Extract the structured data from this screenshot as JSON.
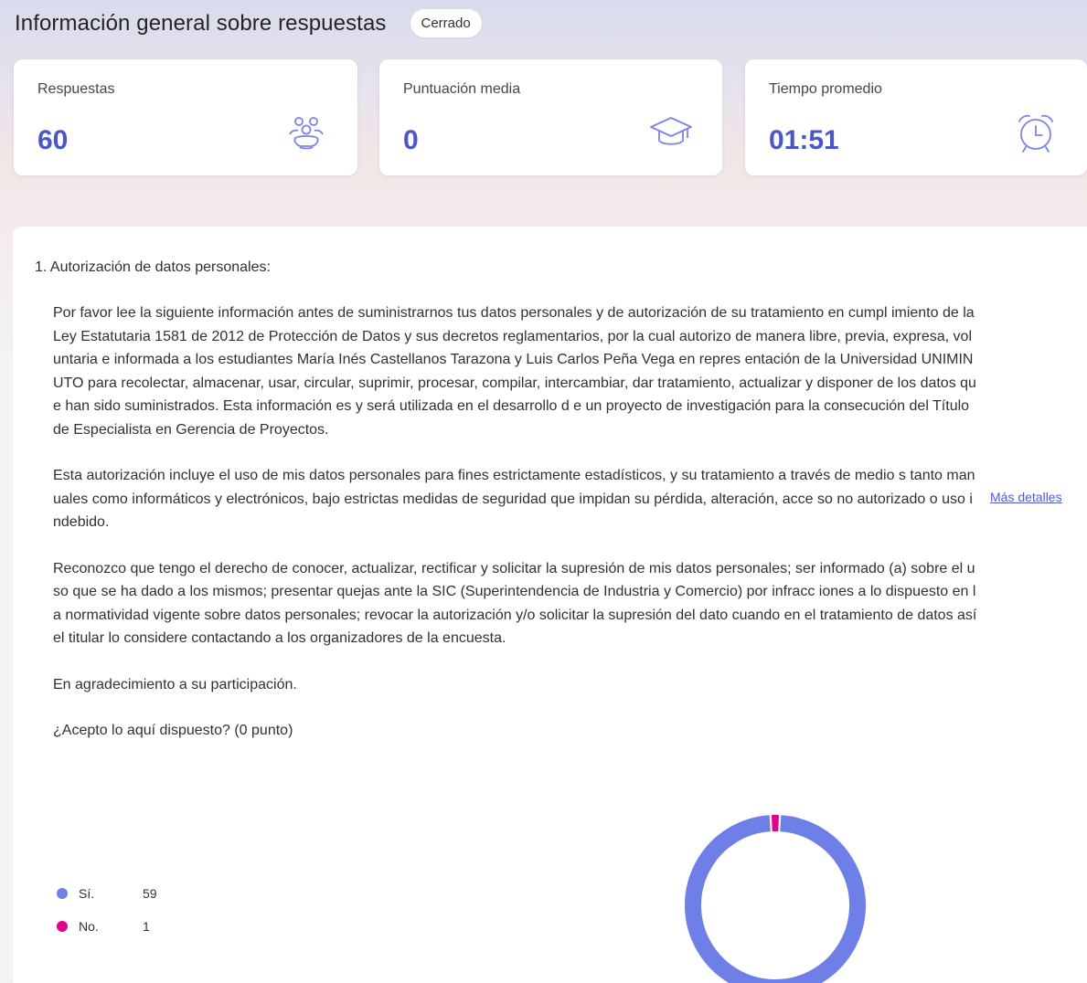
{
  "header": {
    "title": "Información general sobre respuestas",
    "status": "Cerrado"
  },
  "stats": [
    {
      "label": "Respuestas",
      "value": "60",
      "icon": "people-icon"
    },
    {
      "label": "Puntuación media",
      "value": "0",
      "icon": "graduation-cap-icon"
    },
    {
      "label": "Tiempo promedio",
      "value": "01:51",
      "icon": "alarm-clock-icon"
    }
  ],
  "colors": {
    "accent": "#4b57c9",
    "yes": "#6f7fe8",
    "no": "#e3008c"
  },
  "question": {
    "title": "1. Autorización de datos personales:",
    "paragraphs": [
      "Por favor lee la siguiente información antes de suministrarnos tus datos personales y de autorización de su tratamiento en cumpl imiento de la Ley Estatutaria 1581 de 2012 de Protección de Datos y sus decretos reglamentarios, por la cual autorizo de manera libre, previa, expresa, voluntaria e informada a los estudiantes María Inés Castellanos Tarazona  y Luis Carlos Peña Vega en repres entación de la Universidad UNIMINUTO  para recolectar, almacenar, usar, circular, suprimir, procesar, compilar, intercambiar, dar tratamiento, actualizar y disponer de los datos que han sido suministrados.  Esta información es y será utilizada en el desarrollo d e un proyecto de investigación para la consecución del Título de Especialista en Gerencia de Proyectos.",
      "Esta autorización incluye el uso de mis datos personales para fines estrictamente estadísticos, y su tratamiento a través de medio s tanto manuales como informáticos y electrónicos, bajo estrictas medidas de seguridad que impidan su pérdida, alteración, acce so no autorizado o uso indebido.",
      "Reconozco que tengo el derecho de conocer, actualizar, rectificar y solicitar la supresión de mis datos personales; ser informado (a) sobre el uso que se ha dado a los mismos; presentar quejas ante la SIC (Superintendencia de Industria y Comercio) por infracc iones a lo dispuesto en la normatividad vigente sobre datos personales; revocar la autorización y/o solicitar la supresión del dato cuando en el tratamiento de datos así el titular lo considere contactando a los organizadores de la encuesta.",
      "En agradecimiento a su participación.",
      "¿Acepto lo aquí dispuesto? (0 punto)"
    ],
    "more_details": "Más detalles"
  },
  "chart_data": {
    "type": "pie",
    "categories": [
      "Sí.",
      "No."
    ],
    "values": [
      59,
      1
    ],
    "colors": [
      "#6f7fe8",
      "#e3008c"
    ],
    "legend": "left"
  }
}
